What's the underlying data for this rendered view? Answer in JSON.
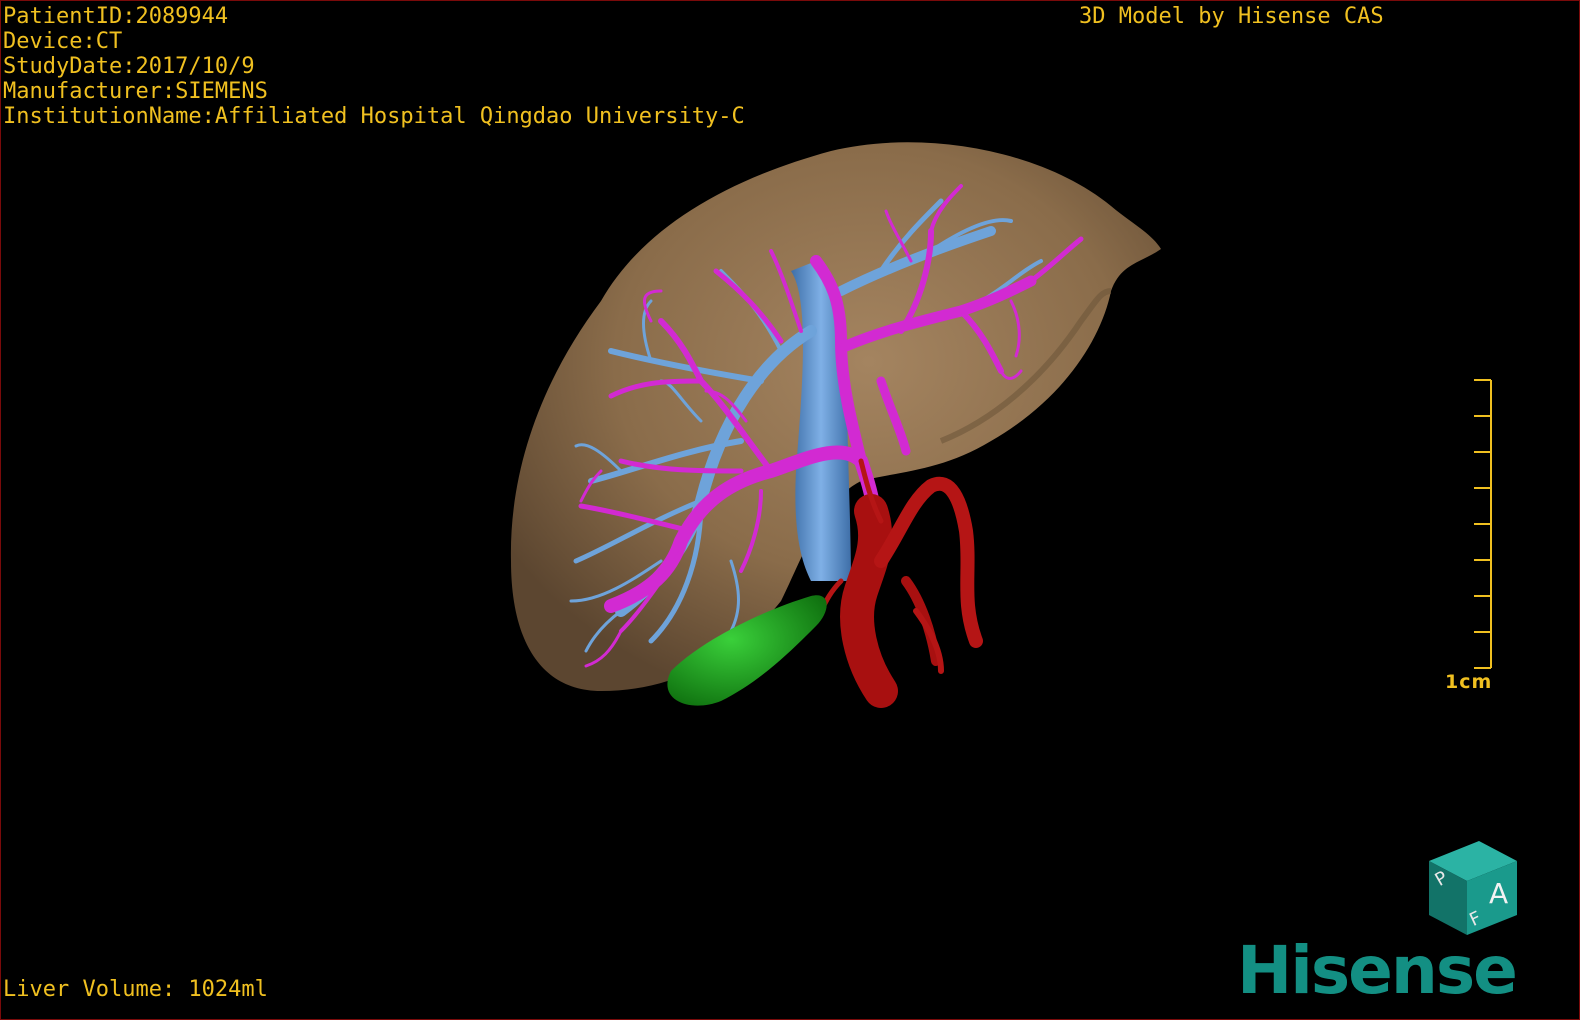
{
  "overlay": {
    "patient_id": "PatientID:2089944",
    "device": "Device:CT",
    "study_date": "StudyDate:2017/10/9",
    "manufacturer": "Manufacturer:SIEMENS",
    "institution": "InstitutionName:Affiliated Hospital Qingdao University-C",
    "model_caption": "3D Model by Hisense CAS",
    "liver_volume": "Liver Volume: 1024ml"
  },
  "scale": {
    "label": "1cm"
  },
  "orientation_cube": {
    "face_front": "A",
    "face_top": "P",
    "face_side": "F"
  },
  "logo": {
    "text": "Hisense"
  },
  "colors": {
    "overlay_text": "#f0c020",
    "background": "#000000",
    "liver": "#8a6c4a",
    "hepatic_vein": "#d22ad2",
    "portal_vein": "#5f95cf",
    "hepatic_artery": "#a81010",
    "gallbladder": "#1c9e1c",
    "logo": "#138f83",
    "cube": "#1a9a8c"
  }
}
